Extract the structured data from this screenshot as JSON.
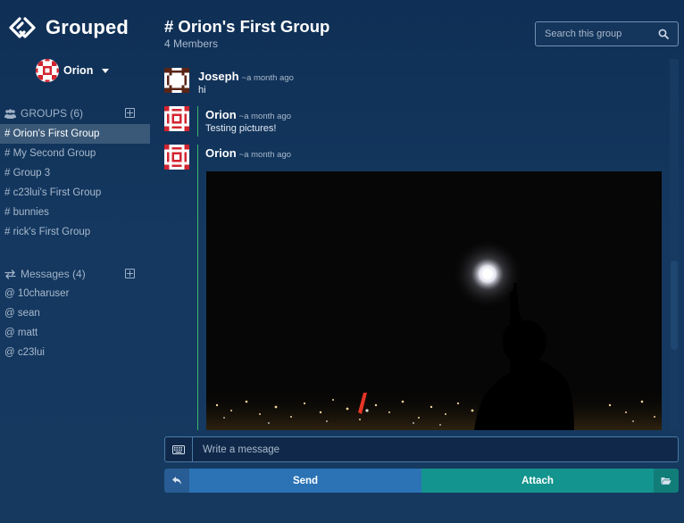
{
  "app": {
    "name": "Grouped",
    "logo_icon": "grouped-logo-icon"
  },
  "user": {
    "name": "Orion",
    "avatar_icon": "identicon-red"
  },
  "sidebar": {
    "groups_header": "GROUPS (6)",
    "groups": [
      {
        "label": "# Orion's First Group",
        "active": true
      },
      {
        "label": "# My Second Group"
      },
      {
        "label": "# Group 3"
      },
      {
        "label": "# c23lui's First Group"
      },
      {
        "label": "# bunnies"
      },
      {
        "label": "# rick's First Group"
      }
    ],
    "messages_header": "Messages (4)",
    "messages": [
      {
        "label": "@ 10charuser"
      },
      {
        "label": "@ sean"
      },
      {
        "label": "@ matt"
      },
      {
        "label": "@ c23lui"
      }
    ]
  },
  "header": {
    "title": "# Orion's First Group",
    "members": "4 Members",
    "search_placeholder": "Search this group"
  },
  "messages": [
    {
      "author": "Joseph",
      "time": "~a month ago",
      "text": "hi",
      "avatar_icon": "identicon-brown"
    },
    {
      "author": "Orion",
      "time": "~a month ago",
      "text": "Testing pictures!",
      "avatar_icon": "identicon-red"
    },
    {
      "author": "Orion",
      "time": "~a month ago",
      "text": "",
      "avatar_icon": "identicon-red",
      "attachment": "night-moon-photo"
    }
  ],
  "composer": {
    "placeholder": "Write a message",
    "send_label": "Send",
    "attach_label": "Attach"
  },
  "colors": {
    "active_item": "#3a5978",
    "send": "#2b73b5",
    "attach": "#14948e",
    "thread_line": "#3fb86a"
  }
}
